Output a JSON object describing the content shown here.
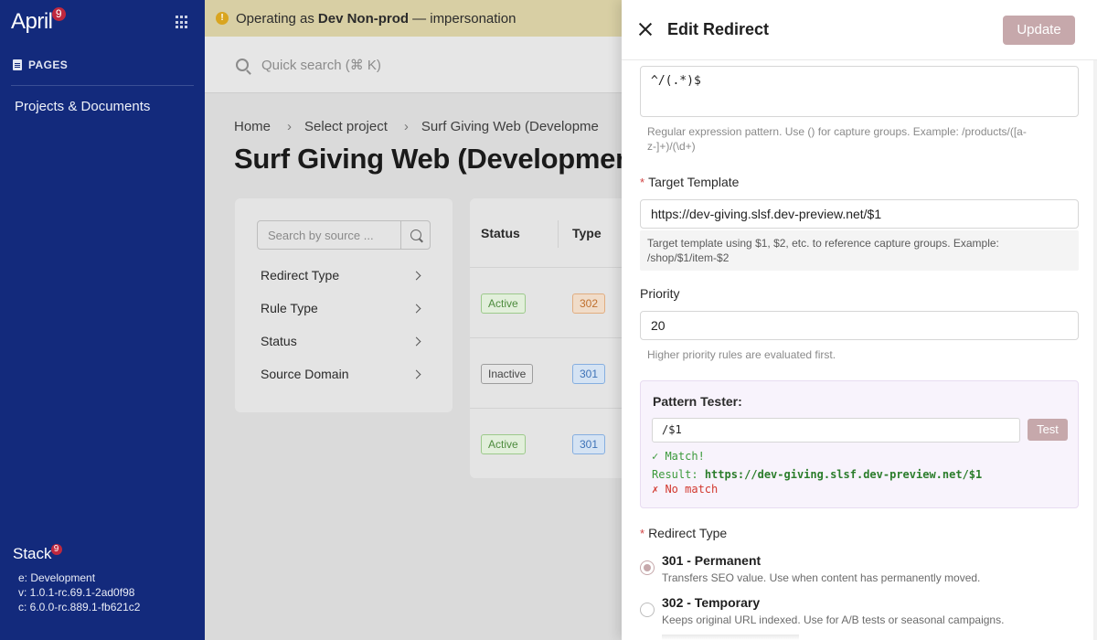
{
  "sidebar": {
    "logo_text": "April",
    "logo_badge": "9",
    "apps_icon": "grid-icon",
    "section_label": "PAGES",
    "nav_items": [
      {
        "label": "Projects & Documents"
      }
    ],
    "stack_logo": "Stack",
    "stack_badge": "9",
    "env": "e: Development",
    "version": "v: 1.0.1-rc.69.1-2ad0f98",
    "core": "c: 6.0.0-rc.889.1-fb621c2"
  },
  "banner": {
    "prefix": "Operating as",
    "account": "Dev Non-prod",
    "suffix": "— impersonation"
  },
  "topbar": {
    "search_placeholder": "Quick search (⌘ K)"
  },
  "breadcrumb": [
    "Home",
    "Select project",
    "Surf Giving Web (Developme"
  ],
  "page_title": "Surf Giving Web (Development",
  "filters": {
    "search_placeholder": "Search by source ...",
    "items": [
      "Redirect Type",
      "Rule Type",
      "Status",
      "Source Domain"
    ]
  },
  "table": {
    "columns": [
      "Status",
      "Type"
    ],
    "rows": [
      {
        "status": "Active",
        "type": "302"
      },
      {
        "status": "Inactive",
        "type": "301"
      },
      {
        "status": "Active",
        "type": "301"
      }
    ]
  },
  "drawer": {
    "title": "Edit Redirect",
    "update_label": "Update",
    "pattern_value": "^/(.*)$",
    "pattern_help": "Regular expression pattern. Use () for capture groups. Example: /products/([a-z-]+)/(\\d+)",
    "target_label": "Target Template",
    "target_value": "https://dev-giving.slsf.dev-preview.net/$1",
    "target_help": "Target template using $1, $2, etc. to reference capture groups. Example: /shop/$1/item-$2",
    "priority_label": "Priority",
    "priority_value": "20",
    "priority_help": "Higher priority rules are evaluated first.",
    "tester": {
      "title": "Pattern Tester:",
      "input_value": "/$1",
      "test_label": "Test",
      "match_text": "✓ Match!",
      "result_label": "Result:",
      "result_url": "https://dev-giving.slsf.dev-preview.net/$1",
      "nomatch_text": "✗ No match"
    },
    "redirect_type_label": "Redirect Type",
    "options": [
      {
        "title": "301 - Permanent",
        "desc": "Transfers SEO value. Use when content has permanently moved.",
        "checked": true
      },
      {
        "title": "302 - Temporary",
        "desc": "Keeps original URL indexed. Use for A/B tests or seasonal campaigns.",
        "checked": false
      }
    ]
  },
  "colors": {
    "sidebar_bg": "#132a7c",
    "accent_disabled": "#c6a8ab",
    "banner_bg": "#d8cfa4",
    "match_green": "#3c9a3c",
    "nomatch_red": "#d2392f"
  }
}
